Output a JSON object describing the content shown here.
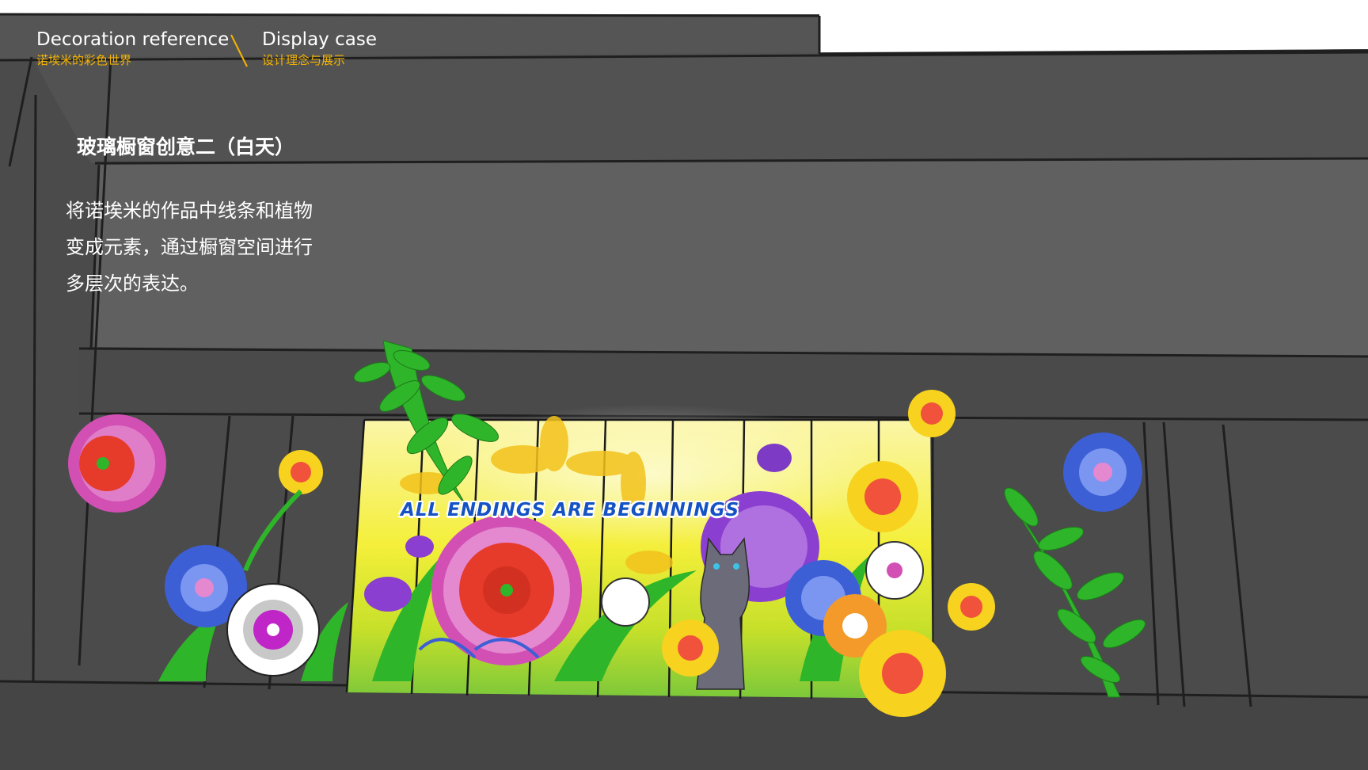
{
  "header": {
    "left": {
      "en": "Decoration reference",
      "cn": "诺埃米的彩色世界"
    },
    "right": {
      "en": "Display case",
      "cn": "设计理念与展示"
    }
  },
  "section": {
    "title": "玻璃橱窗创意二（白天）",
    "body_lines": [
      "将诺埃米的作品中线条和植物",
      "变成元素，通过橱窗空间进行",
      "多层次的表达。"
    ]
  },
  "window_display": {
    "slogan": "ALL ENDINGS ARE BEGINNINGS"
  },
  "colors": {
    "wall_dark": "#4a4a4a",
    "wall_mid": "#5e5e5e",
    "accent_yellow": "#f5b400",
    "leaf_green": "#2fb52a",
    "flower_pink": "#d24fb4",
    "flower_red": "#e63a2a",
    "flower_blue": "#3d5fd6",
    "flower_purple": "#8a3fd0",
    "slogan_blue": "#1553c4"
  }
}
